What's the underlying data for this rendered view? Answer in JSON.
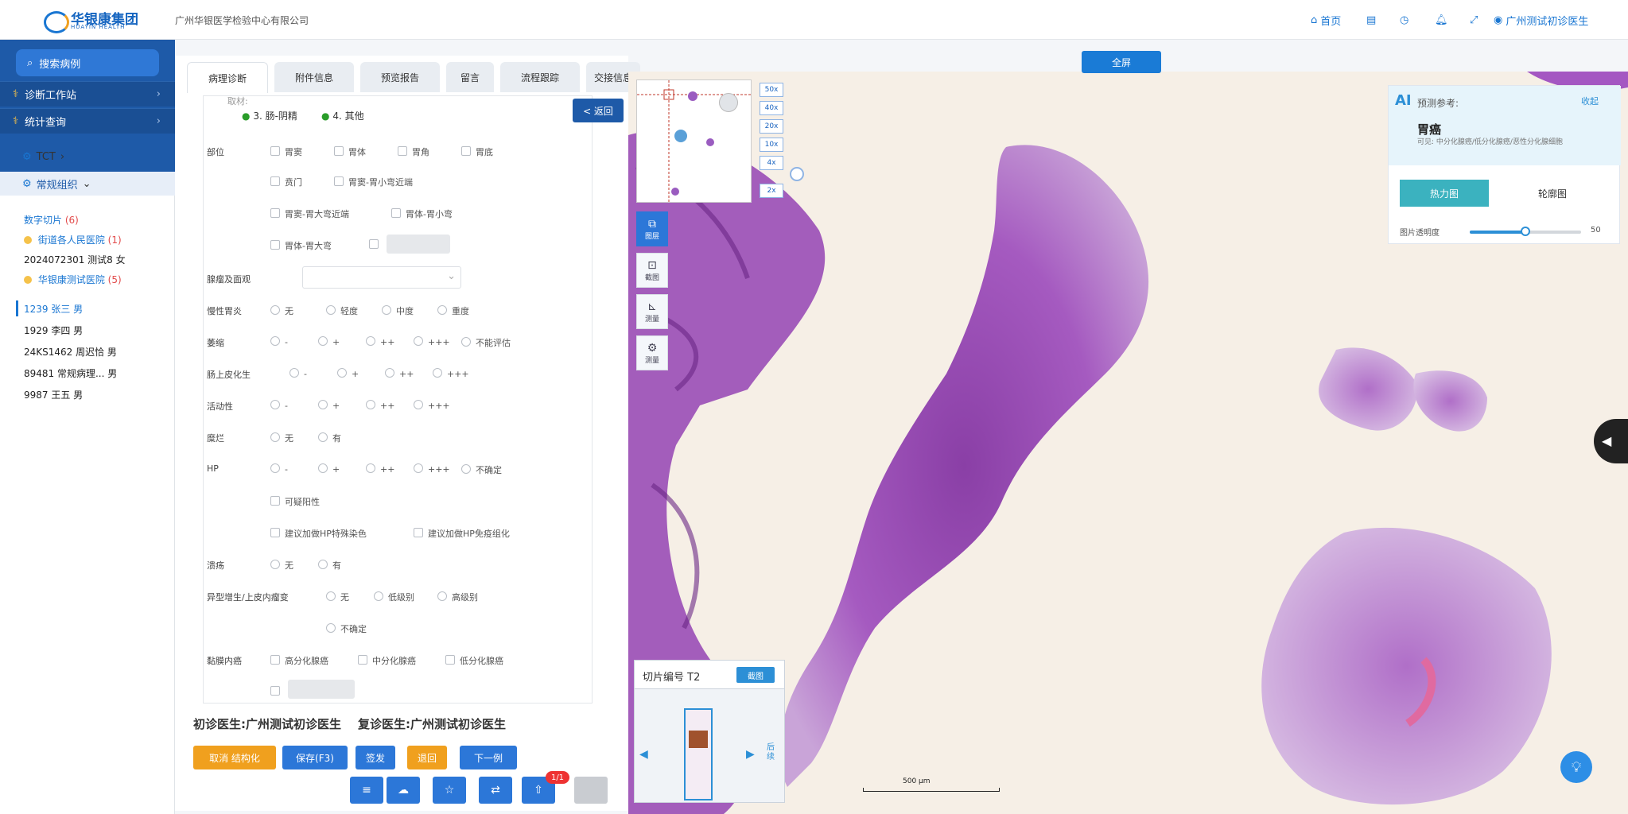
{
  "header": {
    "logo_text": "华银康集团",
    "logo_sub": "HUAYIN HEALTH",
    "company": "广州华银医学检验中心有限公司",
    "nav": [
      {
        "label": "首页",
        "icon": "home-icon"
      },
      {
        "label": "",
        "icon": "document-icon"
      },
      {
        "label": "",
        "icon": "clock-icon"
      },
      {
        "label": "",
        "icon": "bell-icon"
      },
      {
        "label": "",
        "icon": "expand-icon"
      }
    ],
    "user": "广州测试初诊医生"
  },
  "sidebar": {
    "search_label": "搜索病例",
    "menus": [
      "诊断工作站",
      "统计查询"
    ],
    "groups": [
      "TCT",
      "常规组织"
    ],
    "tree": {
      "digital_slides": "数字切片",
      "digital_slides_count": "(6)",
      "hospitals": [
        {
          "name": "街道各人民医院",
          "count": "(1)",
          "cases": [
            "20240723​01  测试8  女"
          ]
        },
        {
          "name": "华银康测试医院",
          "count": "(5)",
          "cases": [
            "1239  张三  男",
            "1929  李四  男",
            "24KS1462  周迟恰  男",
            "89481  常规病理...  男",
            "9987  王五  男"
          ]
        }
      ]
    }
  },
  "tabs": [
    "病理诊断",
    "附件信息",
    "预览报告",
    "留言",
    "流程跟踪",
    "交接信息"
  ],
  "form": {
    "top_partial": [
      "取材:",
      "3. 肠-阴精",
      "4. 其他"
    ],
    "back_label": "< 返回",
    "fields": [
      {
        "label": "部位",
        "options": [
          "胃窦",
          "胃体",
          "胃角",
          "胃底",
          "贲门",
          "胃窦-胃小弯近端",
          "胃窦-胃大弯近端",
          "胃体-胃小弯",
          "胃体-胃大弯"
        ]
      },
      {
        "label": "腺瘤及面观",
        "options": []
      },
      {
        "label": "慢性胃炎",
        "options": [
          "无",
          "轻度",
          "中度",
          "重度"
        ]
      },
      {
        "label": "萎缩",
        "options": [
          "-",
          "+",
          "++",
          "+++",
          "不能评估"
        ]
      },
      {
        "label": "肠上皮化生",
        "options": [
          "-",
          "+",
          "++",
          "+++"
        ]
      },
      {
        "label": "活动性",
        "options": [
          "-",
          "+",
          "++",
          "+++"
        ]
      },
      {
        "label": "糜烂",
        "options": [
          "无",
          "有"
        ]
      },
      {
        "label": "HP",
        "options": [
          "-",
          "+",
          "++",
          "+++",
          "不确定",
          "可疑阳性",
          "建议加做HP特殊染色",
          "建议加做HP免疫组化"
        ]
      },
      {
        "label": "溃疡",
        "options": [
          "无",
          "有"
        ]
      },
      {
        "label": "异型增生/上皮内瘤变",
        "options": [
          "无",
          "低级别",
          "高级别",
          "不确定"
        ]
      },
      {
        "label": "黏膜内癌",
        "options": [
          "高分化腺癌",
          "中分化腺癌",
          "低分化腺癌"
        ]
      }
    ],
    "doctor_initial": "初诊医生:广州测试初诊医生",
    "doctor_review": "复诊医生:广州测试初诊医生",
    "actions": [
      {
        "label": "取消 结构化",
        "color": "#f0a01e"
      },
      {
        "label": "保存(F3)",
        "color": "#2c77d8"
      },
      {
        "label": "签发",
        "color": "#2c77d8"
      },
      {
        "label": "退回",
        "color": "#f0a01e"
      },
      {
        "label": "下一例",
        "color": "#2c77d8"
      }
    ],
    "badge": "1/1"
  },
  "viewer": {
    "fullscreen_label": "全屏",
    "zoom_levels": [
      "50x",
      "40x",
      "20x",
      "10x",
      "4x",
      "2x"
    ],
    "tools": [
      "图层",
      "截图",
      "测量",
      "测量"
    ],
    "ai": {
      "badge": "AI",
      "title": "预测参考:",
      "diagnosis": "胃癌",
      "desc": "可见: 中分化腺癌/低分化腺癌/恶性分化腺细胞",
      "close_label": "收起",
      "btn_active": "热力图",
      "btn_other": "轮廓图",
      "opacity_label": "图片透明度",
      "opacity_value": "50"
    },
    "film_label": "切片编号 T2",
    "film_button": "截图",
    "film_right": "后续",
    "scale_label": "500 μm"
  }
}
